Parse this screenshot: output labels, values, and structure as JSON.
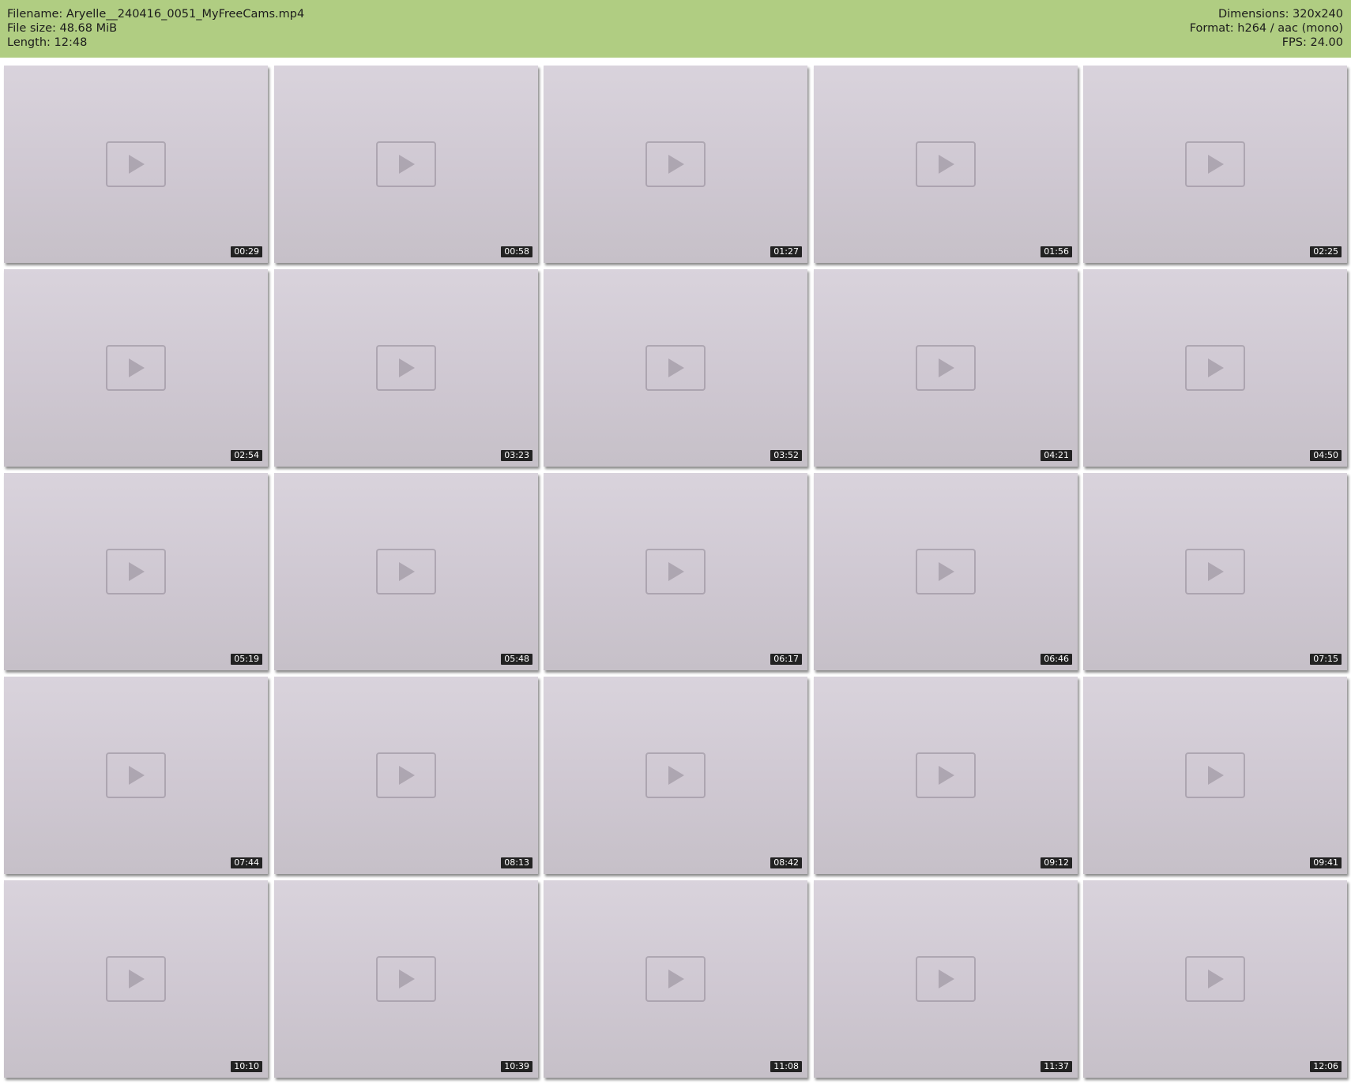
{
  "header": {
    "filename_line": "Filename: Aryelle__240416_0051_MyFreeCams.mp4",
    "filesize_line": "File size: 48.68 MiB",
    "length_line": "Length: 12:48",
    "dimensions_line": "Dimensions: 320x240",
    "format_line": "Format: h264 / aac (mono)",
    "fps_line": "FPS: 24.00"
  },
  "colors": {
    "header_background": "#b0cd82",
    "timestamp_background": "#222222"
  },
  "grid": {
    "columns": 5,
    "rows": 5
  },
  "thumbnails": [
    {
      "timestamp": "00:29"
    },
    {
      "timestamp": "00:58"
    },
    {
      "timestamp": "01:27"
    },
    {
      "timestamp": "01:56"
    },
    {
      "timestamp": "02:25"
    },
    {
      "timestamp": "02:54"
    },
    {
      "timestamp": "03:23"
    },
    {
      "timestamp": "03:52"
    },
    {
      "timestamp": "04:21"
    },
    {
      "timestamp": "04:50"
    },
    {
      "timestamp": "05:19"
    },
    {
      "timestamp": "05:48"
    },
    {
      "timestamp": "06:17"
    },
    {
      "timestamp": "06:46"
    },
    {
      "timestamp": "07:15"
    },
    {
      "timestamp": "07:44"
    },
    {
      "timestamp": "08:13"
    },
    {
      "timestamp": "08:42"
    },
    {
      "timestamp": "09:12"
    },
    {
      "timestamp": "09:41"
    },
    {
      "timestamp": "10:10"
    },
    {
      "timestamp": "10:39"
    },
    {
      "timestamp": "11:08"
    },
    {
      "timestamp": "11:37"
    },
    {
      "timestamp": "12:06"
    }
  ]
}
